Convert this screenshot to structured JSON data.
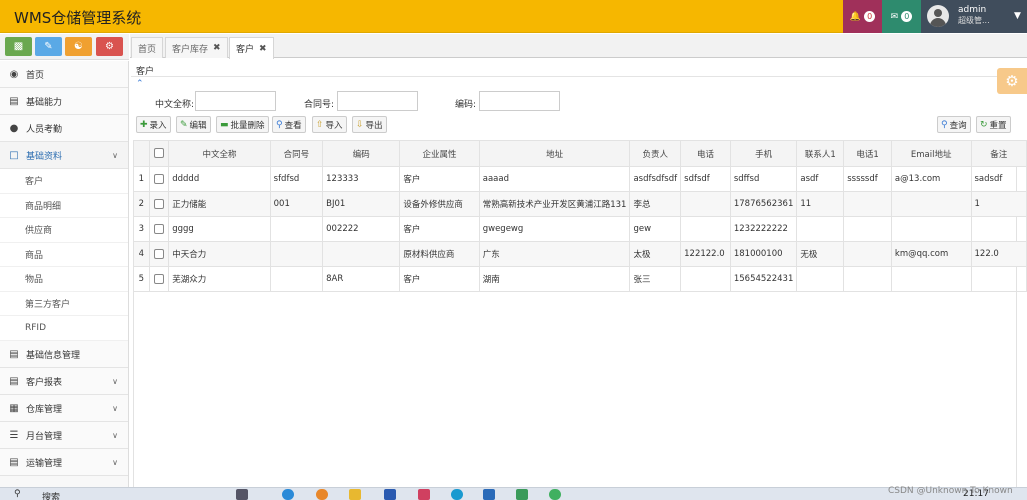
{
  "header": {
    "title": "WMS仓储管理系统",
    "bell_count": "0",
    "mail_count": "0",
    "user_name": "admin",
    "user_role": "超级管..."
  },
  "sidebar": {
    "items": [
      {
        "label": "首页",
        "icon": "dashboard-icon"
      },
      {
        "label": "基础能力",
        "icon": "list-icon"
      },
      {
        "label": "人员考勤",
        "icon": "user-icon"
      },
      {
        "label": "基础资料",
        "icon": "file-icon",
        "expanded": true
      },
      {
        "label": "基础信息管理",
        "icon": "list-icon"
      },
      {
        "label": "客户报表",
        "icon": "list-icon"
      },
      {
        "label": "仓库管理",
        "icon": "building-icon"
      },
      {
        "label": "月台管理",
        "icon": "th-list-icon"
      },
      {
        "label": "运输管理",
        "icon": "list-icon"
      }
    ],
    "sub_items": [
      "客户",
      "商品明细",
      "供应商",
      "商品",
      "物品",
      "第三方客户",
      "RFID"
    ]
  },
  "tabs": [
    {
      "label": "首页"
    },
    {
      "label": "客户库存"
    },
    {
      "label": "客户"
    }
  ],
  "content": {
    "breadcrumb": "客户",
    "filters": {
      "name_label": "中文全称:",
      "contract_label": "合同号:",
      "code_label": "编码:"
    },
    "toolbar": {
      "add": "录入",
      "edit": "编辑",
      "batch_delete": "批量删除",
      "view": "查看",
      "import": "导入",
      "export": "导出",
      "query": "查询",
      "reset": "重置"
    },
    "table": {
      "headers": [
        "中文全称",
        "合同号",
        "编码",
        "企业属性",
        "地址",
        "负责人",
        "电话",
        "手机",
        "联系人1",
        "电话1",
        "Email地址",
        "备注"
      ],
      "rows": [
        {
          "no": "1",
          "cells": [
            "ddddd",
            "sfdfsd",
            "123333",
            "客户",
            "aaaad",
            "asdfsdfsdf",
            "sdfsdf",
            "sdffsd",
            "asdf",
            "sssssdf",
            "a@13.com",
            "sadsdf"
          ]
        },
        {
          "no": "2",
          "cells": [
            "正力储能",
            "001",
            "BJ01",
            "设备外修供应商",
            "常熟高新技术产业开发区黄浦江路131",
            "李总",
            "",
            "17876562361",
            "11",
            "",
            "",
            "1"
          ]
        },
        {
          "no": "3",
          "cells": [
            "gggg",
            "",
            "002222",
            "客户",
            "gwegewg",
            "gew",
            "",
            "1232222222",
            "",
            "",
            "",
            ""
          ]
        },
        {
          "no": "4",
          "cells": [
            "中天合力",
            "",
            "",
            "原材料供应商",
            "广东",
            "太极",
            "122122.0",
            "181000100",
            "无极",
            "",
            "km@qq.com",
            "122.0"
          ]
        },
        {
          "no": "5",
          "cells": [
            "芜湖众力",
            "",
            "8AR",
            "客户",
            "湖南",
            "张三",
            "",
            "15654522431",
            "",
            "",
            "",
            ""
          ]
        }
      ]
    }
  },
  "taskbar": {
    "search": "搜索",
    "time": "21:17"
  },
  "watermark": "CSDN @Unknown To Known"
}
